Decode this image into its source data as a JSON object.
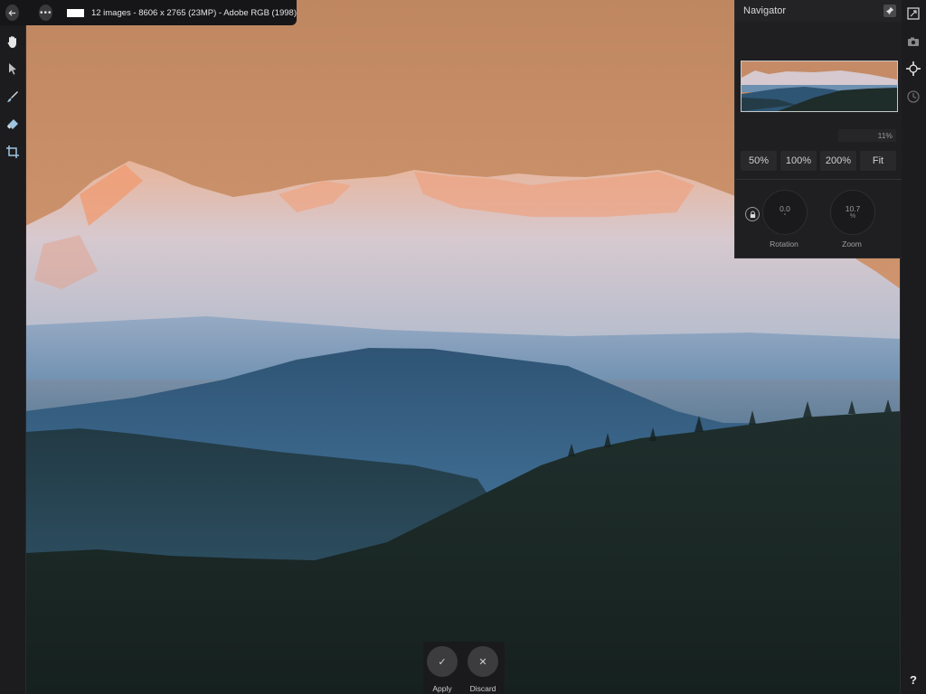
{
  "topbar": {
    "info": "12 images - 8606 x 2765 (23MP) - Adobe RGB (1998)",
    "more_label": "•••"
  },
  "left_tools": [
    "hand-icon",
    "pointer-icon",
    "brush-icon",
    "eraser-icon",
    "crop-icon"
  ],
  "right_tools": [
    "resize-icon",
    "camera-icon",
    "navigator-icon",
    "history-icon"
  ],
  "help_label": "?",
  "navigator": {
    "title": "Navigator",
    "zoom_percent": "11%",
    "zoom_buttons": [
      "50%",
      "100%",
      "200%",
      "Fit"
    ],
    "rotation_value": "0.0",
    "rotation_unit": "°",
    "rotation_label": "Rotation",
    "zoom_value": "10.7",
    "zoom_unit": "%",
    "zoom_label": "Zoom"
  },
  "actions": {
    "apply_label": "Apply",
    "apply_glyph": "✓",
    "discard_label": "Discard",
    "discard_glyph": "✕"
  },
  "colors": {
    "sky_top": "#c28a63",
    "sky_bottom": "#e0a37c",
    "snow": "#d9dfe8",
    "alpenglow": "#f0a27a",
    "haze": "#4a78a0",
    "forest": "#1d2b2a"
  }
}
